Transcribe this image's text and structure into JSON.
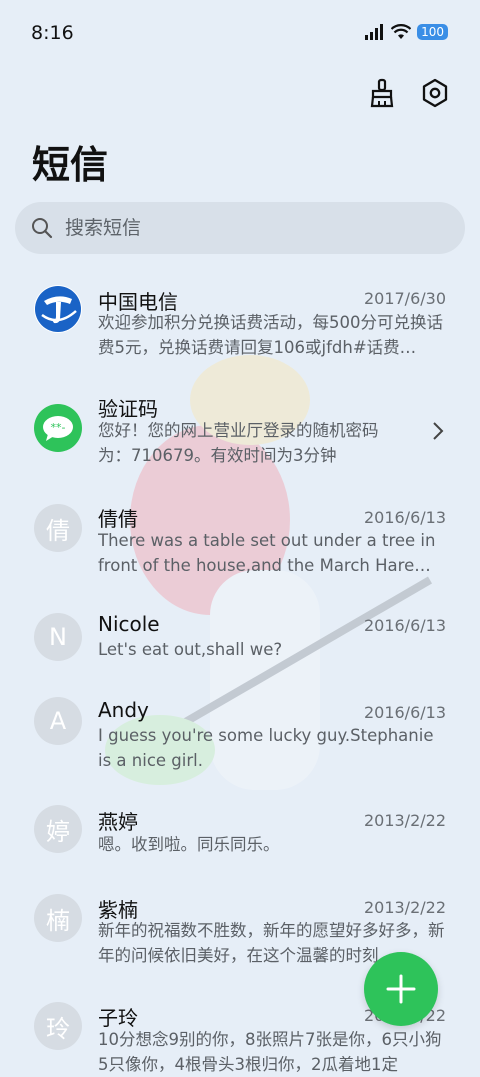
{
  "status": {
    "time": "8:16",
    "battery": "100"
  },
  "header": {
    "title": "短信"
  },
  "search": {
    "placeholder": "搜索短信"
  },
  "conversations": [
    {
      "avatar": "",
      "name": "中国电信",
      "date": "2017/6/30",
      "preview": "欢迎参加积分兑换话费活动，每500分可兑换话费5元，兑换话费请回复106或jfdh#话费…"
    },
    {
      "avatar": "",
      "name": "验证码",
      "date": "",
      "preview": "您好！您的网上营业厅登录的随机密码为：710679。有效时间为3分钟"
    },
    {
      "avatar": "倩",
      "name": "倩倩",
      "date": "2016/6/13",
      "preview": "There was a table set out under a tree in front of the house,and the March Hare an…"
    },
    {
      "avatar": "N",
      "name": "Nicole",
      "date": "2016/6/13",
      "preview": "Let's eat out,shall we?"
    },
    {
      "avatar": "A",
      "name": "Andy",
      "date": "2016/6/13",
      "preview": "I guess you're some lucky guy.Stephanie is a nice girl."
    },
    {
      "avatar": "婷",
      "name": "燕婷",
      "date": "2013/2/22",
      "preview": "嗯。收到啦。同乐同乐。"
    },
    {
      "avatar": "楠",
      "name": "紫楠",
      "date": "2013/2/22",
      "preview": "新年的祝福数不胜数，新年的愿望好多好多，新年的问候依旧美好，在这个温馨的时刻"
    },
    {
      "avatar": "玲",
      "name": "子玲",
      "date": "2013/2/22",
      "preview": "10分想念9别的你，8张照片7张是你，6只小狗5只像你，4根骨头3根归你，2瓜着地1定"
    }
  ],
  "colors": {
    "accent": "#2ec35a",
    "telecom_blue": "#1a63c6"
  },
  "icons": {
    "clean": "broom-icon",
    "settings": "settings-icon",
    "fab": "plus-icon"
  }
}
